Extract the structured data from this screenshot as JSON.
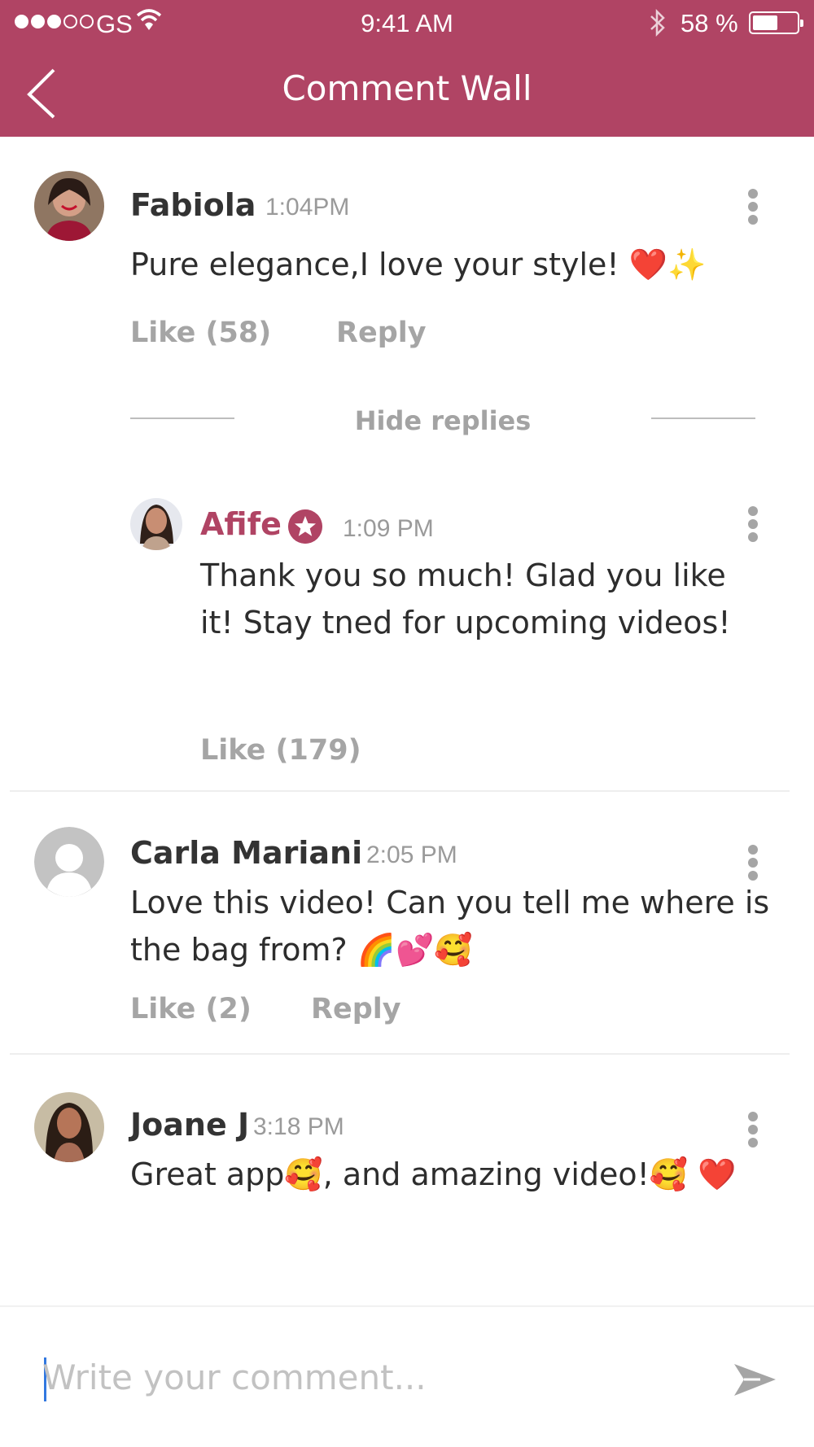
{
  "status_bar": {
    "carrier": "GS",
    "time": "9:41 AM",
    "battery": "58 %",
    "battery_level": 0.58
  },
  "header": {
    "title": "Comment Wall"
  },
  "comments": [
    {
      "author": "Fabiola",
      "time": "1:04PM",
      "text": "Pure elegance,I love your style! ❤️✨",
      "like": "Like (58)",
      "reply": "Reply"
    },
    {
      "author": "Carla Mariani",
      "time": "2:05 PM",
      "text": "Love this video! Can you tell me where is the bag from?  🌈💕🥰",
      "like": "Like (2)",
      "reply": "Reply"
    },
    {
      "author": "Joane J",
      "time": "3:18 PM",
      "text": "Great app🥰, and amazing video!🥰 ❤️"
    }
  ],
  "reply": {
    "author": "Afife",
    "time": "1:09 PM",
    "text": "Thank you so much! Glad you like it! Stay tned for upcoming videos!",
    "like": "Like (179)"
  },
  "hide_replies": "Hide replies",
  "composer": {
    "placeholder": "Write your comment..."
  },
  "colors": {
    "header": "#b04464",
    "muted": "#a5a5a5"
  }
}
